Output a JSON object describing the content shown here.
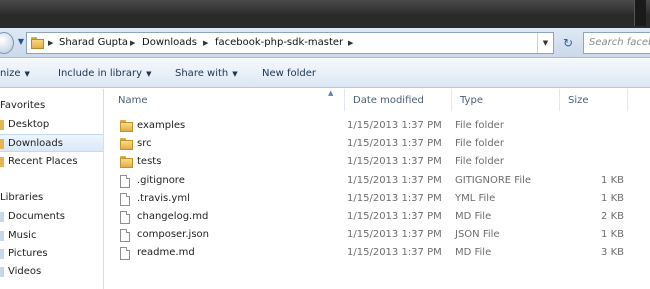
{
  "address_bar": {
    "crumbs": [
      "Sharad Gupta",
      "Downloads",
      "facebook-php-sdk-master"
    ],
    "search_placeholder": "Search facebo"
  },
  "command_bar": {
    "organize": "nize",
    "include_in_library": "Include in library",
    "share_with": "Share with",
    "new_folder": "New folder"
  },
  "nav": {
    "favorites": "Favorites",
    "desktop": "Desktop",
    "downloads": "Downloads",
    "recent_places": "Recent Places",
    "libraries": "Libraries",
    "documents": "Documents",
    "music": "Music",
    "pictures": "Pictures",
    "videos": "Videos"
  },
  "columns": {
    "name": "Name",
    "date_modified": "Date modified",
    "type": "Type",
    "size": "Size"
  },
  "files": [
    {
      "name": "examples",
      "date": "1/15/2013 1:37 PM",
      "type": "File folder",
      "size": "",
      "icon": "folder-icon"
    },
    {
      "name": "src",
      "date": "1/15/2013 1:37 PM",
      "type": "File folder",
      "size": "",
      "icon": "folder-icon"
    },
    {
      "name": "tests",
      "date": "1/15/2013 1:37 PM",
      "type": "File folder",
      "size": "",
      "icon": "folder-icon"
    },
    {
      "name": ".gitignore",
      "date": "1/15/2013 1:37 PM",
      "type": "GITIGNORE File",
      "size": "1 KB",
      "icon": "file-icon"
    },
    {
      "name": ".travis.yml",
      "date": "1/15/2013 1:37 PM",
      "type": "YML File",
      "size": "1 KB",
      "icon": "file-icon"
    },
    {
      "name": "changelog.md",
      "date": "1/15/2013 1:37 PM",
      "type": "MD File",
      "size": "2 KB",
      "icon": "file-icon"
    },
    {
      "name": "composer.json",
      "date": "1/15/2013 1:37 PM",
      "type": "JSON File",
      "size": "1 KB",
      "icon": "file-icon"
    },
    {
      "name": "readme.md",
      "date": "1/15/2013 1:37 PM",
      "type": "MD File",
      "size": "3 KB",
      "icon": "file-icon"
    }
  ],
  "colors": {
    "selected_bg": "#d9e8f9",
    "header_text": "#4c607a",
    "secondary_text": "#6d6d6d"
  }
}
